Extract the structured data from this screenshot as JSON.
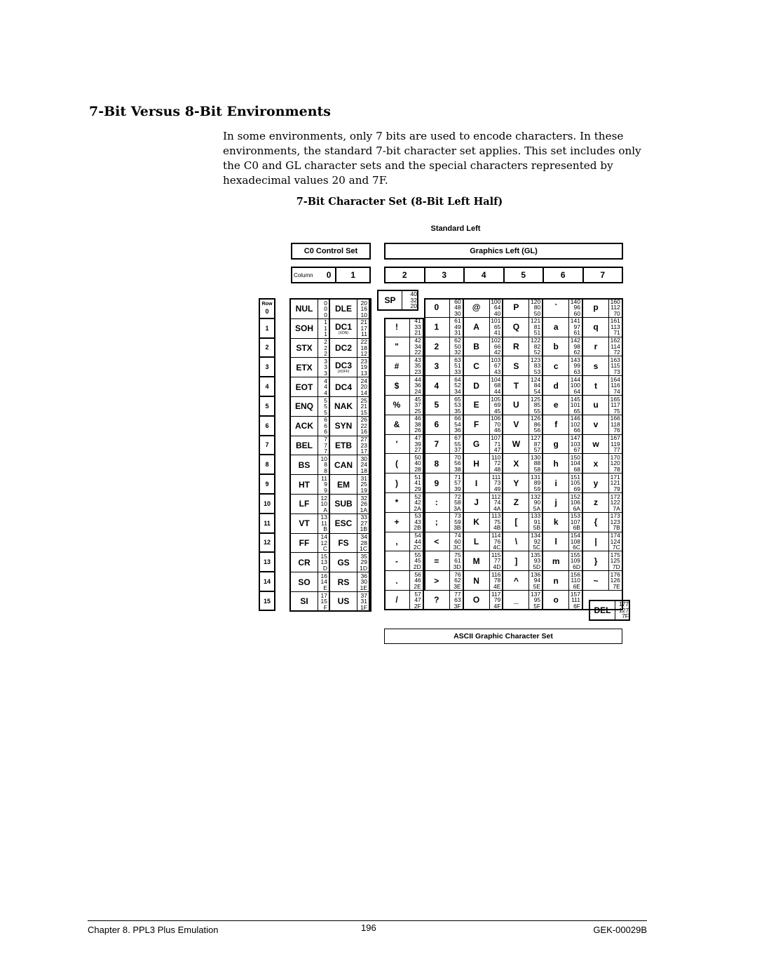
{
  "page": {
    "heading": "7-Bit Versus 8-Bit Environments",
    "paragraph": "In some environments, only 7 bits are used to encode characters. In these environments, the standard 7-bit character set applies. This set includes only the C0 and GL character sets and the special characters represented by hexadecimal values 20 and 7F.",
    "figure_title": "7-Bit Character Set (8-Bit Left Half)"
  },
  "table": {
    "standard_left_label": "Standard Left",
    "c0_label": "C0 Control Set",
    "gl_label": "Graphics Left (GL)",
    "column_label": "Column",
    "row_label": "Row",
    "ascii_label": "ASCII Graphic Character Set",
    "c0_columns": [
      "0",
      "1"
    ],
    "gl_columns": [
      "2",
      "3",
      "4",
      "5",
      "6",
      "7"
    ],
    "rows": [
      "0",
      "1",
      "2",
      "3",
      "4",
      "5",
      "6",
      "7",
      "8",
      "9",
      "10",
      "11",
      "12",
      "13",
      "14",
      "15"
    ],
    "sp": {
      "ch": "SP",
      "oct": "40",
      "dec": "32",
      "hex": "20"
    },
    "del": {
      "ch": "DEL",
      "oct": "177",
      "dec": "127",
      "hex": "7F"
    },
    "col0": [
      {
        "ch": "NUL",
        "oct": "0",
        "dec": "0",
        "hex": "0"
      },
      {
        "ch": "SOH",
        "oct": "1",
        "dec": "1",
        "hex": "1"
      },
      {
        "ch": "STX",
        "oct": "2",
        "dec": "2",
        "hex": "2"
      },
      {
        "ch": "ETX",
        "oct": "3",
        "dec": "3",
        "hex": "3"
      },
      {
        "ch": "EOT",
        "oct": "4",
        "dec": "4",
        "hex": "4"
      },
      {
        "ch": "ENQ",
        "oct": "5",
        "dec": "5",
        "hex": "5"
      },
      {
        "ch": "ACK",
        "oct": "6",
        "dec": "6",
        "hex": "6"
      },
      {
        "ch": "BEL",
        "oct": "7",
        "dec": "7",
        "hex": "7"
      },
      {
        "ch": "BS",
        "oct": "10",
        "dec": "8",
        "hex": "8"
      },
      {
        "ch": "HT",
        "oct": "11",
        "dec": "9",
        "hex": "9"
      },
      {
        "ch": "LF",
        "oct": "12",
        "dec": "10",
        "hex": "A"
      },
      {
        "ch": "VT",
        "oct": "13",
        "dec": "11",
        "hex": "B"
      },
      {
        "ch": "FF",
        "oct": "14",
        "dec": "12",
        "hex": "C"
      },
      {
        "ch": "CR",
        "oct": "15",
        "dec": "13",
        "hex": "D"
      },
      {
        "ch": "SO",
        "oct": "16",
        "dec": "14",
        "hex": "E"
      },
      {
        "ch": "SI",
        "oct": "17",
        "dec": "15",
        "hex": "F"
      }
    ],
    "col1": [
      {
        "ch": "DLE",
        "oct": "20",
        "dec": "16",
        "hex": "10"
      },
      {
        "ch": "DC1",
        "sub": "(XON)",
        "oct": "21",
        "dec": "17",
        "hex": "11"
      },
      {
        "ch": "DC2",
        "oct": "22",
        "dec": "18",
        "hex": "12"
      },
      {
        "ch": "DC3",
        "sub": "(XOFF)",
        "oct": "23",
        "dec": "19",
        "hex": "13"
      },
      {
        "ch": "DC4",
        "oct": "24",
        "dec": "20",
        "hex": "14"
      },
      {
        "ch": "NAK",
        "oct": "25",
        "dec": "21",
        "hex": "15"
      },
      {
        "ch": "SYN",
        "oct": "26",
        "dec": "22",
        "hex": "16"
      },
      {
        "ch": "ETB",
        "oct": "27",
        "dec": "23",
        "hex": "17"
      },
      {
        "ch": "CAN",
        "oct": "30",
        "dec": "24",
        "hex": "18"
      },
      {
        "ch": "EM",
        "oct": "31",
        "dec": "25",
        "hex": "19"
      },
      {
        "ch": "SUB",
        "oct": "32",
        "dec": "26",
        "hex": "1A"
      },
      {
        "ch": "ESC",
        "oct": "33",
        "dec": "27",
        "hex": "1B"
      },
      {
        "ch": "FS",
        "oct": "34",
        "dec": "28",
        "hex": "1C"
      },
      {
        "ch": "GS",
        "oct": "35",
        "dec": "29",
        "hex": "1D"
      },
      {
        "ch": "RS",
        "oct": "36",
        "dec": "30",
        "hex": "1E"
      },
      {
        "ch": "US",
        "oct": "37",
        "dec": "31",
        "hex": "1F"
      }
    ],
    "col2": [
      null,
      {
        "ch": "!",
        "oct": "41",
        "dec": "33",
        "hex": "21"
      },
      {
        "ch": "\"",
        "oct": "42",
        "dec": "34",
        "hex": "22"
      },
      {
        "ch": "#",
        "oct": "43",
        "dec": "35",
        "hex": "23"
      },
      {
        "ch": "$",
        "oct": "44",
        "dec": "36",
        "hex": "24"
      },
      {
        "ch": "%",
        "oct": "45",
        "dec": "37",
        "hex": "25"
      },
      {
        "ch": "&",
        "oct": "46",
        "dec": "38",
        "hex": "26"
      },
      {
        "ch": "'",
        "oct": "47",
        "dec": "39",
        "hex": "27"
      },
      {
        "ch": "(",
        "oct": "50",
        "dec": "40",
        "hex": "28"
      },
      {
        "ch": ")",
        "oct": "51",
        "dec": "41",
        "hex": "29"
      },
      {
        "ch": "*",
        "oct": "52",
        "dec": "42",
        "hex": "2A"
      },
      {
        "ch": "+",
        "oct": "53",
        "dec": "43",
        "hex": "2B"
      },
      {
        "ch": ",",
        "oct": "54",
        "dec": "44",
        "hex": "2C"
      },
      {
        "ch": "-",
        "oct": "55",
        "dec": "45",
        "hex": "2D"
      },
      {
        "ch": ".",
        "oct": "56",
        "dec": "46",
        "hex": "2E"
      },
      {
        "ch": "/",
        "oct": "57",
        "dec": "47",
        "hex": "2F"
      }
    ],
    "col3": [
      {
        "ch": "0",
        "oct": "60",
        "dec": "48",
        "hex": "30"
      },
      {
        "ch": "1",
        "oct": "61",
        "dec": "49",
        "hex": "31"
      },
      {
        "ch": "2",
        "oct": "62",
        "dec": "50",
        "hex": "32"
      },
      {
        "ch": "3",
        "oct": "63",
        "dec": "51",
        "hex": "33"
      },
      {
        "ch": "4",
        "oct": "64",
        "dec": "52",
        "hex": "34"
      },
      {
        "ch": "5",
        "oct": "65",
        "dec": "53",
        "hex": "35"
      },
      {
        "ch": "6",
        "oct": "66",
        "dec": "54",
        "hex": "36"
      },
      {
        "ch": "7",
        "oct": "67",
        "dec": "55",
        "hex": "37"
      },
      {
        "ch": "8",
        "oct": "70",
        "dec": "56",
        "hex": "38"
      },
      {
        "ch": "9",
        "oct": "71",
        "dec": "57",
        "hex": "39"
      },
      {
        "ch": ":",
        "oct": "72",
        "dec": "58",
        "hex": "3A"
      },
      {
        "ch": ";",
        "oct": "73",
        "dec": "59",
        "hex": "3B"
      },
      {
        "ch": "<",
        "oct": "74",
        "dec": "60",
        "hex": "3C"
      },
      {
        "ch": "=",
        "oct": "75",
        "dec": "61",
        "hex": "3D"
      },
      {
        "ch": ">",
        "oct": "76",
        "dec": "62",
        "hex": "3E"
      },
      {
        "ch": "?",
        "oct": "77",
        "dec": "63",
        "hex": "3F"
      }
    ],
    "col4": [
      {
        "ch": "@",
        "oct": "100",
        "dec": "64",
        "hex": "40"
      },
      {
        "ch": "A",
        "oct": "101",
        "dec": "65",
        "hex": "41"
      },
      {
        "ch": "B",
        "oct": "102",
        "dec": "66",
        "hex": "42"
      },
      {
        "ch": "C",
        "oct": "103",
        "dec": "67",
        "hex": "43"
      },
      {
        "ch": "D",
        "oct": "104",
        "dec": "68",
        "hex": "44"
      },
      {
        "ch": "E",
        "oct": "105",
        "dec": "69",
        "hex": "45"
      },
      {
        "ch": "F",
        "oct": "106",
        "dec": "70",
        "hex": "46"
      },
      {
        "ch": "G",
        "oct": "107",
        "dec": "71",
        "hex": "47"
      },
      {
        "ch": "H",
        "oct": "110",
        "dec": "72",
        "hex": "48"
      },
      {
        "ch": "I",
        "oct": "111",
        "dec": "73",
        "hex": "49"
      },
      {
        "ch": "J",
        "oct": "112",
        "dec": "74",
        "hex": "4A"
      },
      {
        "ch": "K",
        "oct": "113",
        "dec": "75",
        "hex": "4B"
      },
      {
        "ch": "L",
        "oct": "114",
        "dec": "76",
        "hex": "4C"
      },
      {
        "ch": "M",
        "oct": "115",
        "dec": "77",
        "hex": "4D"
      },
      {
        "ch": "N",
        "oct": "116",
        "dec": "78",
        "hex": "4E"
      },
      {
        "ch": "O",
        "oct": "117",
        "dec": "79",
        "hex": "4F"
      }
    ],
    "col5": [
      {
        "ch": "P",
        "oct": "120",
        "dec": "80",
        "hex": "50"
      },
      {
        "ch": "Q",
        "oct": "121",
        "dec": "81",
        "hex": "51"
      },
      {
        "ch": "R",
        "oct": "122",
        "dec": "82",
        "hex": "52"
      },
      {
        "ch": "S",
        "oct": "123",
        "dec": "83",
        "hex": "53"
      },
      {
        "ch": "T",
        "oct": "124",
        "dec": "84",
        "hex": "54"
      },
      {
        "ch": "U",
        "oct": "125",
        "dec": "85",
        "hex": "55"
      },
      {
        "ch": "V",
        "oct": "126",
        "dec": "86",
        "hex": "56"
      },
      {
        "ch": "W",
        "oct": "127",
        "dec": "87",
        "hex": "57"
      },
      {
        "ch": "X",
        "oct": "130",
        "dec": "88",
        "hex": "58"
      },
      {
        "ch": "Y",
        "oct": "131",
        "dec": "89",
        "hex": "59"
      },
      {
        "ch": "Z",
        "oct": "132",
        "dec": "90",
        "hex": "5A"
      },
      {
        "ch": "[",
        "oct": "133",
        "dec": "91",
        "hex": "5B"
      },
      {
        "ch": "\\",
        "oct": "134",
        "dec": "92",
        "hex": "5C"
      },
      {
        "ch": "]",
        "oct": "135",
        "dec": "93",
        "hex": "5D"
      },
      {
        "ch": "^",
        "oct": "136",
        "dec": "94",
        "hex": "5E"
      },
      {
        "ch": "_",
        "oct": "137",
        "dec": "95",
        "hex": "5F"
      }
    ],
    "col6": [
      {
        "ch": "`",
        "oct": "140",
        "dec": "96",
        "hex": "60"
      },
      {
        "ch": "a",
        "oct": "141",
        "dec": "97",
        "hex": "61"
      },
      {
        "ch": "b",
        "oct": "142",
        "dec": "98",
        "hex": "62"
      },
      {
        "ch": "c",
        "oct": "143",
        "dec": "99",
        "hex": "63"
      },
      {
        "ch": "d",
        "oct": "144",
        "dec": "100",
        "hex": "64"
      },
      {
        "ch": "e",
        "oct": "145",
        "dec": "101",
        "hex": "65"
      },
      {
        "ch": "f",
        "oct": "146",
        "dec": "102",
        "hex": "66"
      },
      {
        "ch": "g",
        "oct": "147",
        "dec": "103",
        "hex": "67"
      },
      {
        "ch": "h",
        "oct": "150",
        "dec": "104",
        "hex": "68"
      },
      {
        "ch": "i",
        "oct": "151",
        "dec": "105",
        "hex": "69"
      },
      {
        "ch": "j",
        "oct": "152",
        "dec": "106",
        "hex": "6A"
      },
      {
        "ch": "k",
        "oct": "153",
        "dec": "107",
        "hex": "6B"
      },
      {
        "ch": "l",
        "oct": "154",
        "dec": "108",
        "hex": "6C"
      },
      {
        "ch": "m",
        "oct": "155",
        "dec": "109",
        "hex": "6D"
      },
      {
        "ch": "n",
        "oct": "156",
        "dec": "110",
        "hex": "6E"
      },
      {
        "ch": "o",
        "oct": "157",
        "dec": "111",
        "hex": "6F"
      }
    ],
    "col7": [
      {
        "ch": "p",
        "oct": "160",
        "dec": "112",
        "hex": "70"
      },
      {
        "ch": "q",
        "oct": "161",
        "dec": "113",
        "hex": "71"
      },
      {
        "ch": "r",
        "oct": "162",
        "dec": "114",
        "hex": "72"
      },
      {
        "ch": "s",
        "oct": "163",
        "dec": "115",
        "hex": "73"
      },
      {
        "ch": "t",
        "oct": "164",
        "dec": "116",
        "hex": "74"
      },
      {
        "ch": "u",
        "oct": "165",
        "dec": "117",
        "hex": "75"
      },
      {
        "ch": "v",
        "oct": "166",
        "dec": "118",
        "hex": "76"
      },
      {
        "ch": "w",
        "oct": "167",
        "dec": "119",
        "hex": "77"
      },
      {
        "ch": "x",
        "oct": "170",
        "dec": "120",
        "hex": "78"
      },
      {
        "ch": "y",
        "oct": "171",
        "dec": "121",
        "hex": "79"
      },
      {
        "ch": "z",
        "oct": "172",
        "dec": "122",
        "hex": "7A"
      },
      {
        "ch": "{",
        "oct": "173",
        "dec": "123",
        "hex": "7B"
      },
      {
        "ch": "|",
        "oct": "174",
        "dec": "124",
        "hex": "7C"
      },
      {
        "ch": "}",
        "oct": "175",
        "dec": "125",
        "hex": "7D"
      },
      {
        "ch": "~",
        "oct": "176",
        "dec": "126",
        "hex": "7E"
      },
      null
    ]
  },
  "footer": {
    "chapter": "Chapter 8. PPL3 Plus Emulation",
    "page_number": "196",
    "doc_id": "GEK-00029B"
  }
}
